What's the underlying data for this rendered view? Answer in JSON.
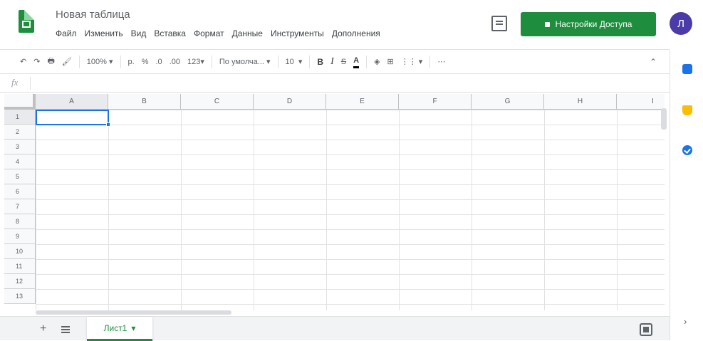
{
  "header": {
    "doc_title": "Новая таблица",
    "menu": [
      "Файл",
      "Изменить",
      "Вид",
      "Вставка",
      "Формат",
      "Данные",
      "Инструменты",
      "Дополнения"
    ],
    "share_label": "Настройки Доступа",
    "avatar_letter": "Л"
  },
  "toolbar": {
    "zoom": "100%",
    "currency": "р.",
    "percent": "%",
    "decimal_dec": ".0",
    "decimal_inc": ".00",
    "number_format": "123",
    "font_family": "По умолча...",
    "font_size": "10",
    "bold": "B",
    "italic": "I",
    "strike": "S",
    "text_color": "A",
    "more": "⋯"
  },
  "formula": {
    "fx": "fx"
  },
  "grid": {
    "columns": [
      "A",
      "B",
      "C",
      "D",
      "E",
      "F",
      "G",
      "H",
      "I"
    ],
    "rows": [
      "1",
      "2",
      "3",
      "4",
      "5",
      "6",
      "7",
      "8",
      "9",
      "10",
      "11",
      "12",
      "13"
    ],
    "selected_cell": "A1"
  },
  "sheets": {
    "active_tab": "Лист1"
  },
  "colors": {
    "brand_green": "#1e8e3e",
    "selection_blue": "#1a73e8",
    "avatar_purple": "#4a3ba8"
  }
}
